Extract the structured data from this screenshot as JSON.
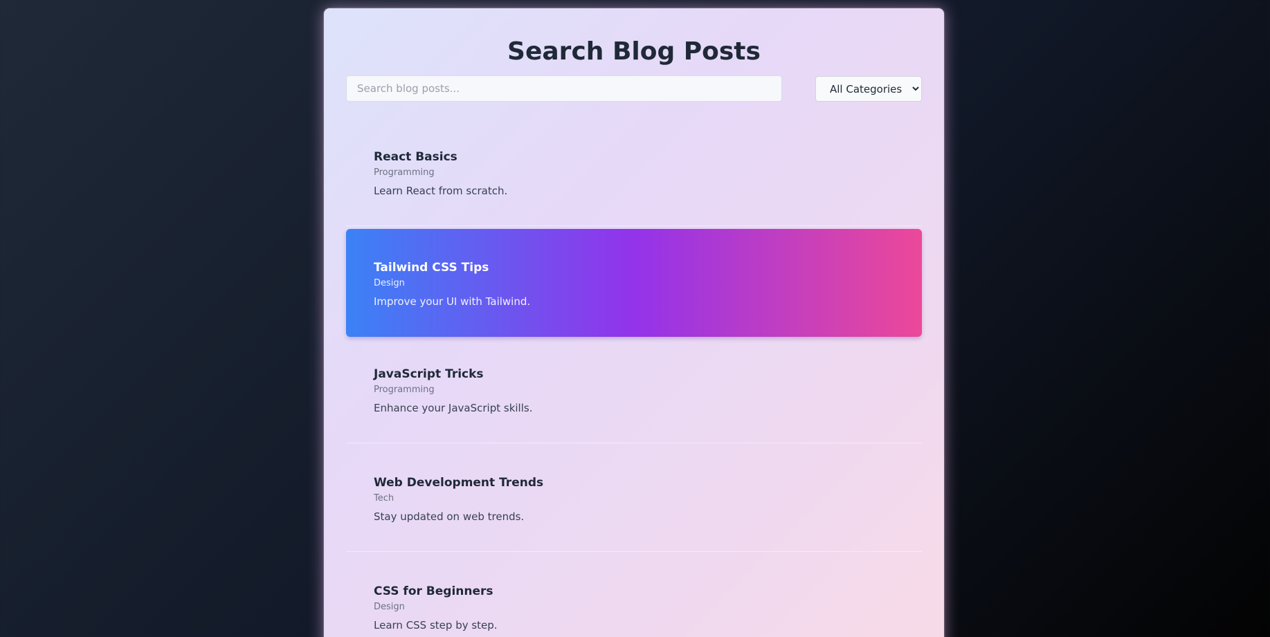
{
  "page": {
    "title": "Search Blog Posts"
  },
  "search": {
    "placeholder": "Search blog posts...",
    "value": ""
  },
  "filter": {
    "selected": "All Categories",
    "options": [
      "All Categories"
    ]
  },
  "posts": [
    {
      "title": "React Basics",
      "category": "Programming",
      "description": "Learn React from scratch.",
      "highlighted": false
    },
    {
      "title": "Tailwind CSS Tips",
      "category": "Design",
      "description": "Improve your UI with Tailwind.",
      "highlighted": true
    },
    {
      "title": "JavaScript Tricks",
      "category": "Programming",
      "description": "Enhance your JavaScript skills.",
      "highlighted": false
    },
    {
      "title": "Web Development Trends",
      "category": "Tech",
      "description": "Stay updated on web trends.",
      "highlighted": false
    },
    {
      "title": "CSS for Beginners",
      "category": "Design",
      "description": "Learn CSS step by step.",
      "highlighted": false
    }
  ],
  "colors": {
    "highlight_gradient": [
      "#3b82f6",
      "#9333ea",
      "#ec4899"
    ],
    "title_text": "#1f2937",
    "background_dark": "#111827"
  }
}
